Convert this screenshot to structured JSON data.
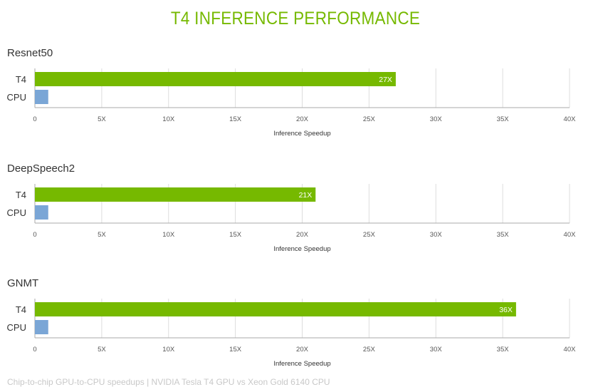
{
  "title": "T4 INFERENCE PERFORMANCE",
  "caption": "Chip-to-chip GPU-to-CPU speedups | NVIDIA Tesla T4 GPU vs Xeon Gold 6140 CPU",
  "colors": {
    "t4": "#76b900",
    "cpu": "#7aa6d6",
    "title": "#76b900",
    "grid": "#dddddd",
    "axis": "#aaaaaa",
    "text": "#333333",
    "tick": "#555555"
  },
  "chart_data": [
    {
      "type": "bar",
      "orientation": "horizontal",
      "title": "Resnet50",
      "categories": [
        "T4",
        "CPU"
      ],
      "values": [
        27,
        1
      ],
      "data_labels": [
        "27X",
        ""
      ],
      "xlabel": "Inference Speedup",
      "xlim": [
        0,
        40
      ],
      "xticks": [
        "0",
        "5X",
        "10X",
        "15X",
        "20X",
        "25X",
        "30X",
        "35X",
        "40X"
      ],
      "grid": true
    },
    {
      "type": "bar",
      "orientation": "horizontal",
      "title": "DeepSpeech2",
      "categories": [
        "T4",
        "CPU"
      ],
      "values": [
        21,
        1
      ],
      "data_labels": [
        "21X",
        ""
      ],
      "xlabel": "Inference Speedup",
      "xlim": [
        0,
        40
      ],
      "xticks": [
        "0",
        "5X",
        "10X",
        "15X",
        "20X",
        "25X",
        "30X",
        "35X",
        "40X"
      ],
      "grid": true
    },
    {
      "type": "bar",
      "orientation": "horizontal",
      "title": "GNMT",
      "categories": [
        "T4",
        "CPU"
      ],
      "values": [
        36,
        1
      ],
      "data_labels": [
        "36X",
        ""
      ],
      "xlabel": "Inference Speedup",
      "xlim": [
        0,
        40
      ],
      "xticks": [
        "0",
        "5X",
        "10X",
        "15X",
        "20X",
        "25X",
        "30X",
        "35X",
        "40X"
      ],
      "grid": true
    }
  ]
}
